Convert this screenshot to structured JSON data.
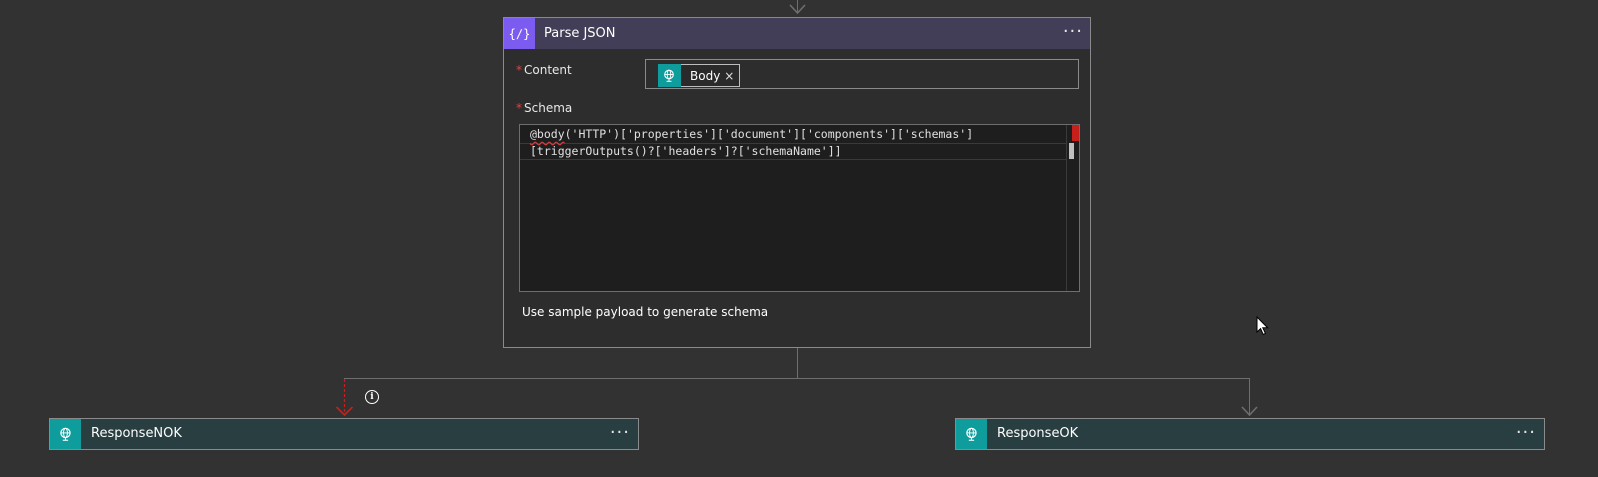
{
  "parse_json": {
    "title": "Parse JSON",
    "icon": "braces-icon",
    "icon_glyph": "{∕}",
    "more_glyph": "···",
    "content": {
      "label": "Content",
      "required_mark": "*",
      "token": {
        "label": "Body",
        "icon": "globe-icon",
        "remove_glyph": "×"
      }
    },
    "schema": {
      "label": "Schema",
      "required_mark": "*",
      "code_line_1a": "@body",
      "code_line_1b": "('HTTP')",
      "code_line_1c": "['properties']['document']['components']['schemas']",
      "code_line_2": "[triggerOutputs()?['headers']?['schemaName']]"
    },
    "sample_link": "Use sample payload to generate schema",
    "accent_color": "#7c5cf0",
    "header_color": "#433e57"
  },
  "response_nok": {
    "title": "ResponseNOK",
    "icon": "globe-icon",
    "more_glyph": "···"
  },
  "response_ok": {
    "title": "ResponseOK",
    "icon": "globe-icon",
    "more_glyph": "···"
  },
  "info": {
    "glyph": "i"
  },
  "colors": {
    "background": "#323232",
    "response_header": "#283e41",
    "http_icon": "#0e9c9c",
    "error_connector": "#c7201c"
  }
}
